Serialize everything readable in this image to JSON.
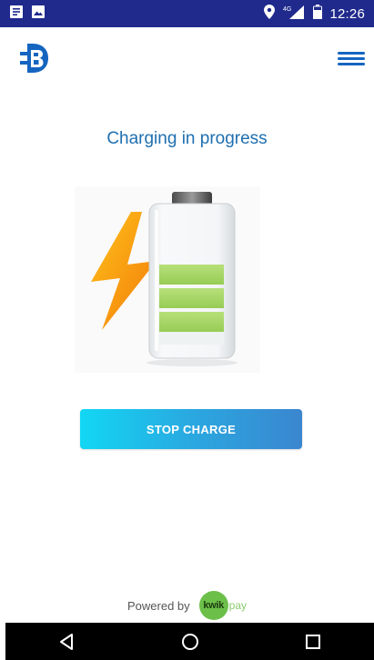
{
  "status_bar": {
    "time": "12:26",
    "network": "4G",
    "bg_color": "#1f2a8c",
    "left_icons": [
      "notification-icon",
      "image-icon"
    ],
    "right_icons": [
      "location-icon",
      "signal-icon",
      "battery-icon"
    ]
  },
  "app_bar": {
    "logo_icon": "plug-logo-icon",
    "menu_icon": "hamburger-menu-icon",
    "accent_color": "#1565c0"
  },
  "main": {
    "status_title": "Charging in progress",
    "battery_level": 0.75,
    "stop_button_label": "STOP CHARGE"
  },
  "footer": {
    "powered_by": "Powered by",
    "brand_kwik": "kwik",
    "brand_pay": "pay"
  },
  "nav_bar": {
    "buttons": [
      "back-icon",
      "home-icon",
      "recents-icon"
    ]
  }
}
